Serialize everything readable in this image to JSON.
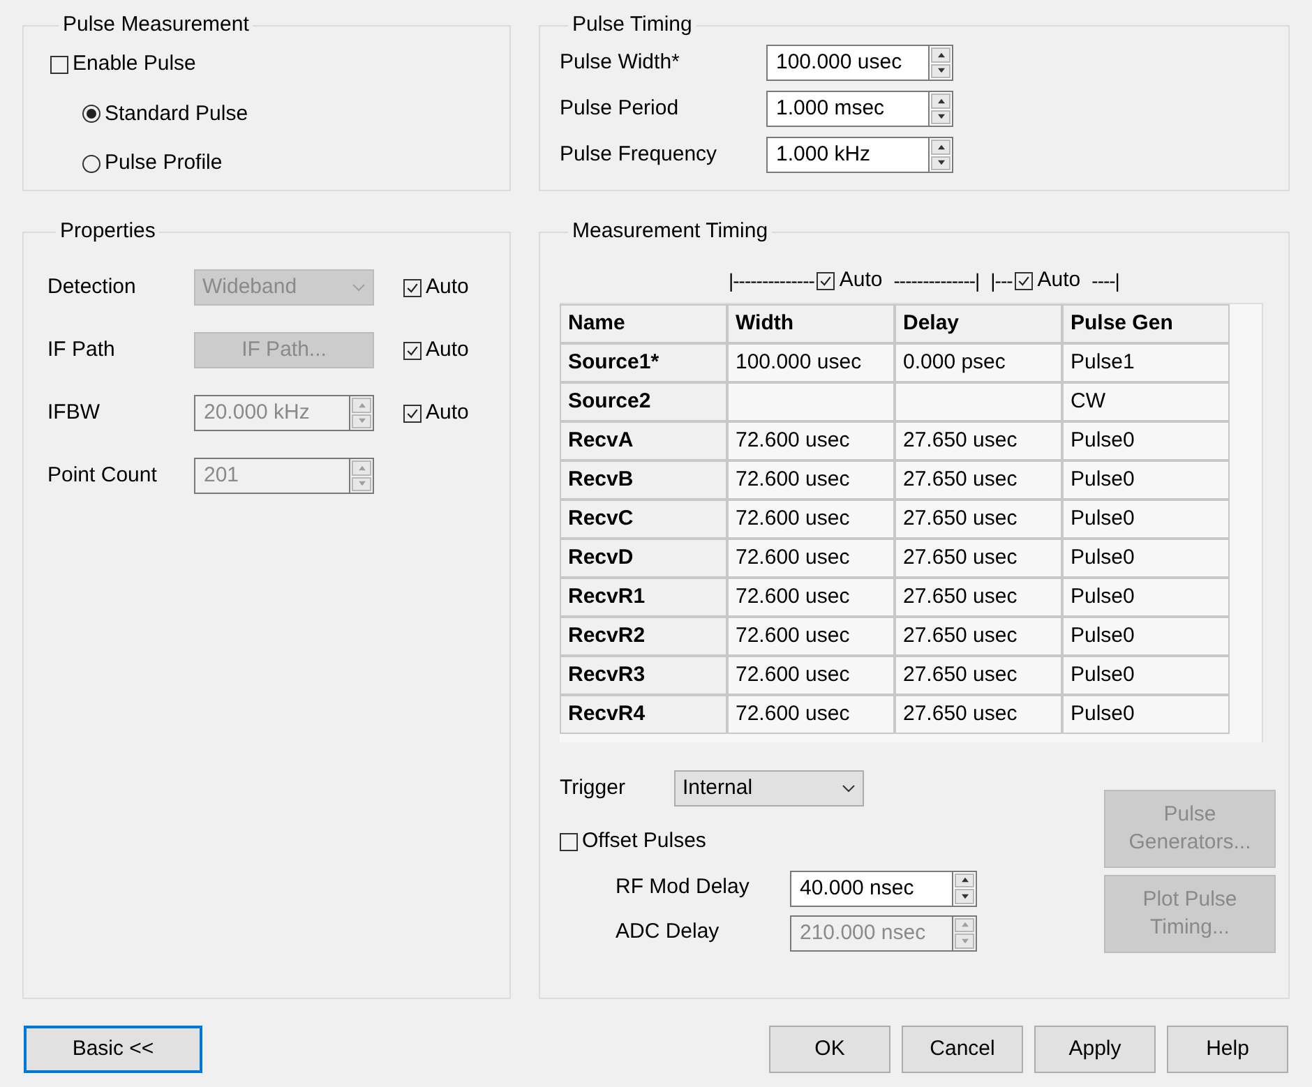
{
  "pulse_measurement": {
    "title": "Pulse Measurement",
    "enable": {
      "label": "Enable Pulse",
      "checked": false
    },
    "modes": [
      {
        "label": "Standard Pulse",
        "selected": true
      },
      {
        "label": "Pulse Profile",
        "selected": false
      }
    ]
  },
  "pulse_timing": {
    "title": "Pulse Timing",
    "fields": [
      {
        "label": "Pulse Width*",
        "value": "100.000 usec"
      },
      {
        "label": "Pulse Period",
        "value": "1.000 msec"
      },
      {
        "label": "Pulse Frequency",
        "value": "1.000 kHz"
      }
    ]
  },
  "properties": {
    "title": "Properties",
    "rows": [
      {
        "kind": "dropdown",
        "label": "Detection",
        "value": "Wideband",
        "disabled": true,
        "auto": {
          "label": "Auto",
          "checked": true
        }
      },
      {
        "kind": "button",
        "label": "IF Path",
        "value": "IF Path...",
        "disabled": true,
        "auto": {
          "label": "Auto",
          "checked": true
        }
      },
      {
        "kind": "spin",
        "label": "IFBW",
        "value": "20.000 kHz",
        "disabled": true,
        "auto": {
          "label": "Auto",
          "checked": true
        }
      },
      {
        "kind": "spin",
        "label": "Point Count",
        "value": "201",
        "disabled": true
      }
    ]
  },
  "measurement_timing": {
    "title": "Measurement Timing",
    "auto_groups": [
      {
        "left": "|--------------",
        "label": "Auto",
        "checked": true,
        "right": "--------------|"
      },
      {
        "left": "|---",
        "label": "Auto",
        "checked": true,
        "right": "----|"
      }
    ],
    "table": {
      "columns": [
        "Name",
        "Width",
        "Delay",
        "Pulse Gen"
      ],
      "rows": [
        [
          "Source1*",
          "100.000 usec",
          "0.000 psec",
          "Pulse1"
        ],
        [
          "Source2",
          null,
          null,
          "CW"
        ],
        [
          "RecvA",
          "72.600 usec",
          "27.650 usec",
          "Pulse0"
        ],
        [
          "RecvB",
          "72.600 usec",
          "27.650 usec",
          "Pulse0"
        ],
        [
          "RecvC",
          "72.600 usec",
          "27.650 usec",
          "Pulse0"
        ],
        [
          "RecvD",
          "72.600 usec",
          "27.650 usec",
          "Pulse0"
        ],
        [
          "RecvR1",
          "72.600 usec",
          "27.650 usec",
          "Pulse0"
        ],
        [
          "RecvR2",
          "72.600 usec",
          "27.650 usec",
          "Pulse0"
        ],
        [
          "RecvR3",
          "72.600 usec",
          "27.650 usec",
          "Pulse0"
        ],
        [
          "RecvR4",
          "72.600 usec",
          "27.650 usec",
          "Pulse0"
        ]
      ]
    },
    "trigger": {
      "label": "Trigger",
      "value": "Internal"
    },
    "offset_pulses": {
      "label": "Offset Pulses",
      "checked": false
    },
    "delays": [
      {
        "label": "RF Mod Delay",
        "value": "40.000 nsec",
        "disabled": false
      },
      {
        "label": "ADC Delay",
        "value": "210.000 nsec",
        "disabled": true
      }
    ],
    "side_buttons": [
      {
        "label": "Pulse Generators...",
        "disabled": true
      },
      {
        "label": "Plot Pulse Timing...",
        "disabled": true
      }
    ]
  },
  "buttons": [
    {
      "label": "Basic <<",
      "focused": true
    },
    {
      "label": "OK",
      "focused": false
    },
    {
      "label": "Cancel",
      "focused": false
    },
    {
      "label": "Apply",
      "focused": false
    },
    {
      "label": "Help",
      "focused": false
    }
  ]
}
